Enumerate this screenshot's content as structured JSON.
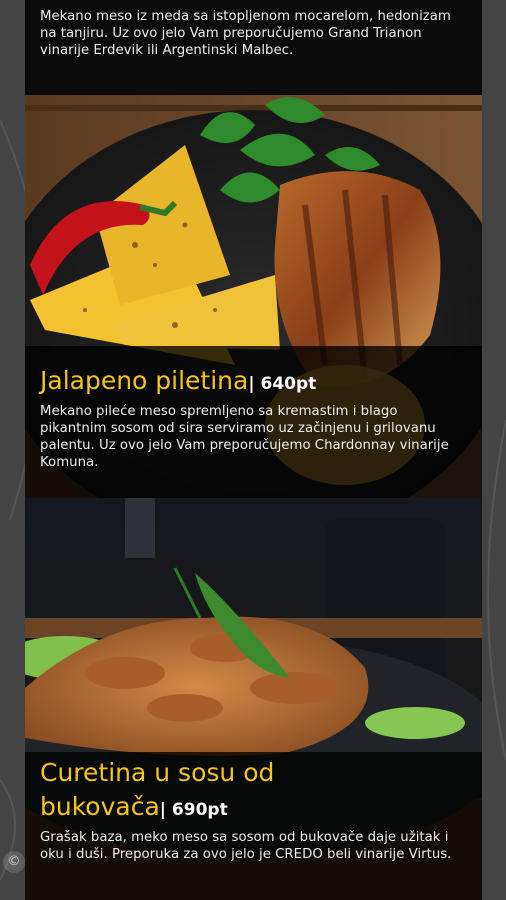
{
  "menu": {
    "previous_item": {
      "description": "Mekano meso iz meda sa istopljenom mocarelom, hedonizam na tanjiru. Uz ovo jelo Vam preporučujemo Grand Trianon vinarije Erdevik ili Argentinski Malbec."
    },
    "items": [
      {
        "title": "Jalapeno piletina",
        "price": "| 640pt",
        "description": "Mekano pileće meso spremljeno sa kremastim i blago pikantnim sosom od sira serviramo uz začinjenu i grilovanu palentu. Uz ovo jelo Vam preporučujemo Chardonnay vinarije Komuna.",
        "photo_icon": "grilled-chicken-polenta-photo"
      },
      {
        "title_line1": "Curetina u sosu od",
        "title_line2": "bukovača",
        "price": "| 690pt",
        "description": "Grašak baza, meko meso sa sosom od bukovače daje užitak i oku i duši. Preporuka za ovo jelo je CREDO beli vinarije Virtus.",
        "photo_icon": "turkey-mushroom-sauce-photo"
      }
    ]
  },
  "floating": {
    "icon": "copyright-icon",
    "glyph": "©"
  },
  "colors": {
    "accent": "#f5c518",
    "overlay": "#000000",
    "text": "#ededed"
  }
}
